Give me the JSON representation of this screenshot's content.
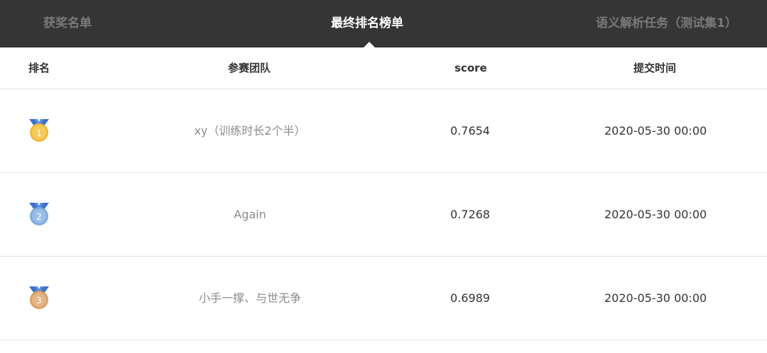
{
  "tabs": [
    {
      "label": "获奖名单",
      "active": false
    },
    {
      "label": "最终排名榜单",
      "active": true
    },
    {
      "label": "语义解析任务（测试集1）",
      "active": false
    }
  ],
  "table": {
    "headers": {
      "rank": "排名",
      "team": "参赛团队",
      "score": "score",
      "time": "提交时间"
    },
    "rows": [
      {
        "rank": "1",
        "medal_icon": "gold-medal-icon",
        "team": "xy（训练时长2个半）",
        "score": "0.7654",
        "time": "2020-05-30 00:00"
      },
      {
        "rank": "2",
        "medal_icon": "silver-medal-icon",
        "team": "Again",
        "score": "0.7268",
        "time": "2020-05-30 00:00"
      },
      {
        "rank": "3",
        "medal_icon": "bronze-medal-icon",
        "team": "小手一撑、与世无争",
        "score": "0.6989",
        "time": "2020-05-30 00:00"
      }
    ]
  },
  "colors": {
    "topbar_bg": "#353535",
    "active_tab": "#ffffff",
    "inactive_tab": "#7a7a7a",
    "ribbon": "#3d72c9",
    "gold": "#f0b93b",
    "silver": "#7fa9df",
    "bronze": "#d9a06a"
  }
}
